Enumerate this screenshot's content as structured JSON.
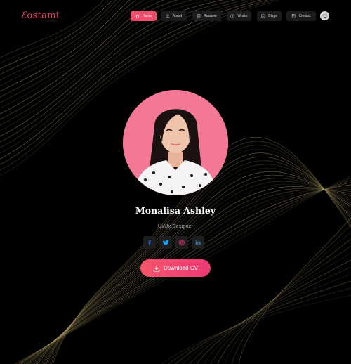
{
  "logo": {
    "text": "ostami"
  },
  "nav": {
    "items": [
      {
        "label": "Home",
        "icon": "home-icon",
        "active": true
      },
      {
        "label": "About",
        "icon": "user-icon",
        "active": false
      },
      {
        "label": "Resume",
        "icon": "document-icon",
        "active": false
      },
      {
        "label": "Works",
        "icon": "briefcase-icon",
        "active": false
      },
      {
        "label": "Blogs",
        "icon": "image-icon",
        "active": false
      },
      {
        "label": "Contact",
        "icon": "address-book-icon",
        "active": false
      }
    ],
    "theme_toggle_icon": "sun-icon"
  },
  "profile": {
    "name": "Monalisa Ashley",
    "role": "Ui/Ux Designer",
    "socials": [
      "facebook-icon",
      "twitter-icon",
      "instagram-icon",
      "linkedin-icon"
    ],
    "download_label": "Download CV"
  },
  "colors": {
    "accent": "#ef4e6c",
    "background": "#000000",
    "contour_lines": "#b9a66b",
    "social_facebook": "#2f6fdc",
    "social_twitter": "#1d9bf0",
    "social_instagram": "#e1306c",
    "social_linkedin": "#2f76b8"
  }
}
